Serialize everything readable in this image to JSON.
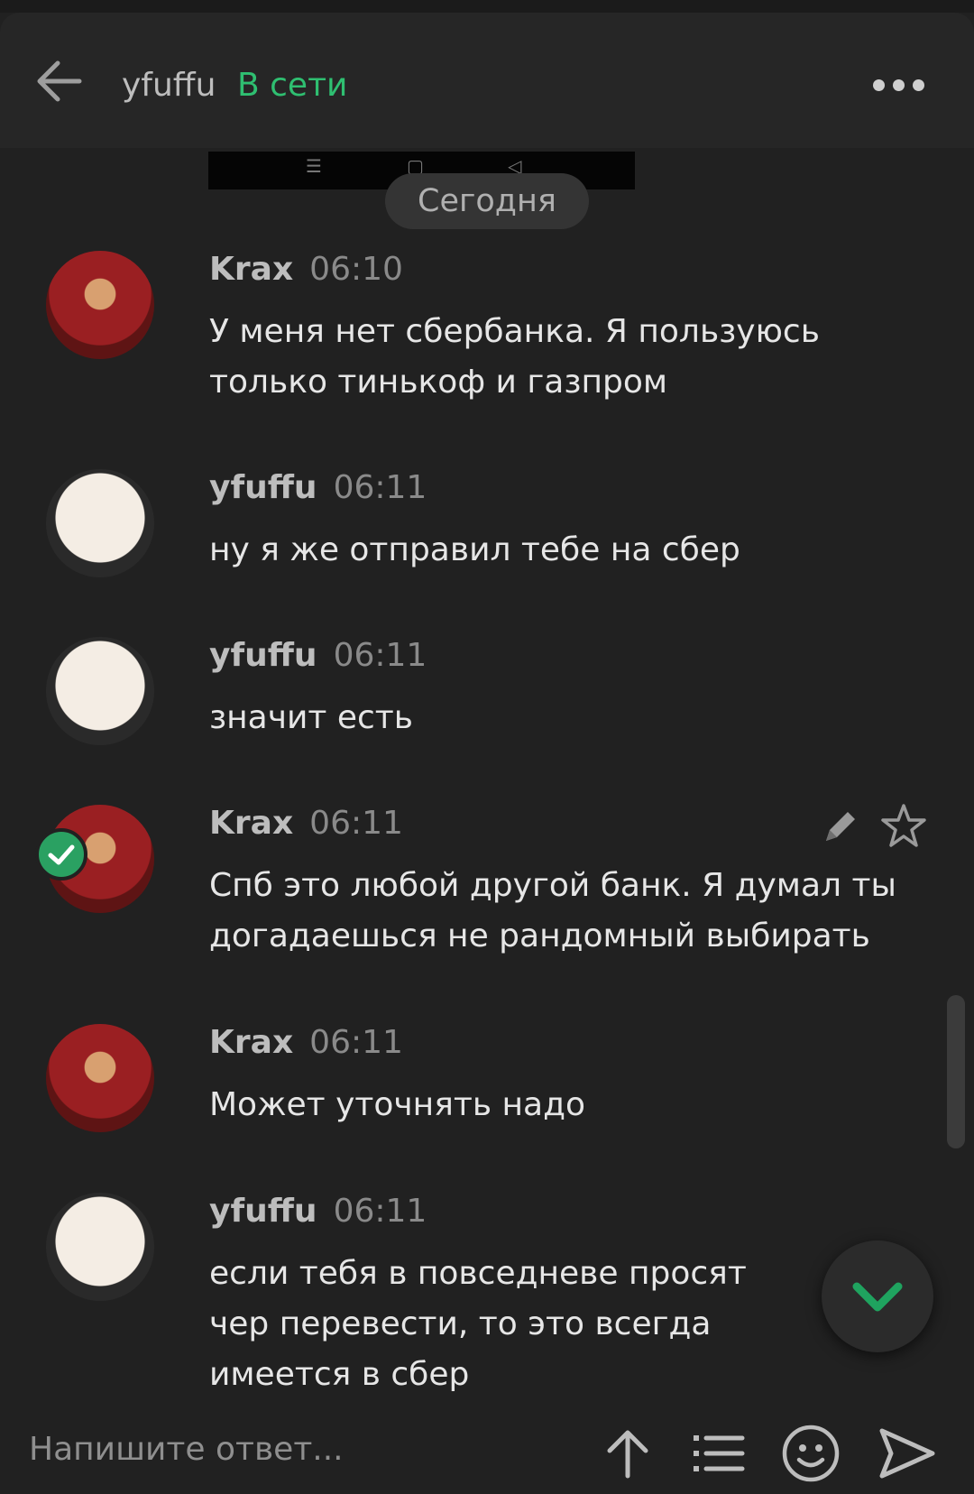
{
  "header": {
    "contact_name": "yfuffu",
    "status": "В сети"
  },
  "system_nav": {
    "menu_glyph": "☰",
    "home_glyph": "▢",
    "back_glyph": "◁"
  },
  "date_separator": "Сегодня",
  "messages": [
    {
      "author": "Krax",
      "time": "06:10",
      "text": "У меня нет сбербанка. Я пользуюсь только тинькоф и газпром",
      "avatar": "krax-avatar"
    },
    {
      "author": "yfuffu",
      "time": "06:11",
      "text": "ну я же отправил тебе на сбер",
      "avatar": "cat-avatar"
    },
    {
      "author": "yfuffu",
      "time": "06:11",
      "text": "значит есть",
      "avatar": "cat-avatar"
    },
    {
      "author": "Krax",
      "time": "06:11",
      "text": "Спб это любой другой банк. Я думал ты догадаешься не рандомный выбирать",
      "avatar": "krax-avatar",
      "selected": true
    },
    {
      "author": "Krax",
      "time": "06:11",
      "text": "Может уточнять надо",
      "avatar": "krax-avatar"
    },
    {
      "author": "yfuffu",
      "time": "06:11",
      "text": "если тебя в повседневе просят чер перевести, то это всегда имеется в сбер",
      "avatar": "cat-avatar"
    }
  ],
  "composer": {
    "placeholder": "Напишите ответ..."
  },
  "colors": {
    "background": "#212121",
    "accent_green": "#2fbf71",
    "fab_arrow": "#1fa35f"
  },
  "icons": [
    "back-arrow-icon",
    "more-dots-icon",
    "check-badge-icon",
    "pencil-icon",
    "star-icon",
    "chevron-down-icon",
    "upload-arrow-icon",
    "list-icon",
    "emoji-icon",
    "send-icon"
  ]
}
